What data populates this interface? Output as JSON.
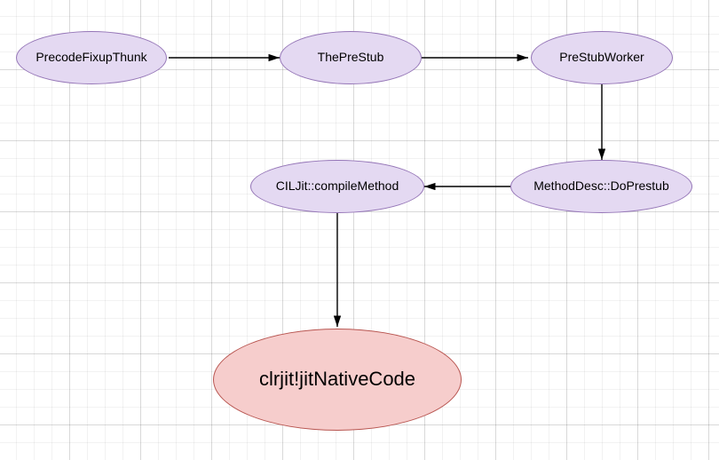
{
  "diagram": {
    "nodes": {
      "precode": {
        "label": "PrecodeFixupThunk"
      },
      "prestub": {
        "label": "ThePreStub"
      },
      "worker": {
        "label": "PreStubWorker"
      },
      "doprestub": {
        "label": "MethodDesc::DoPrestub"
      },
      "compile": {
        "label": "CILJit::compileMethod"
      },
      "native": {
        "label": "clrjit!jitNativeCode"
      }
    },
    "edges": [
      {
        "from": "precode",
        "to": "prestub"
      },
      {
        "from": "prestub",
        "to": "worker"
      },
      {
        "from": "worker",
        "to": "doprestub"
      },
      {
        "from": "doprestub",
        "to": "compile"
      },
      {
        "from": "compile",
        "to": "native"
      }
    ],
    "colors": {
      "purpleFill": "#E4D9F2",
      "purpleStroke": "#9576B7",
      "redFill": "#F6CDCC",
      "redStroke": "#B85550",
      "arrow": "#000000"
    }
  }
}
